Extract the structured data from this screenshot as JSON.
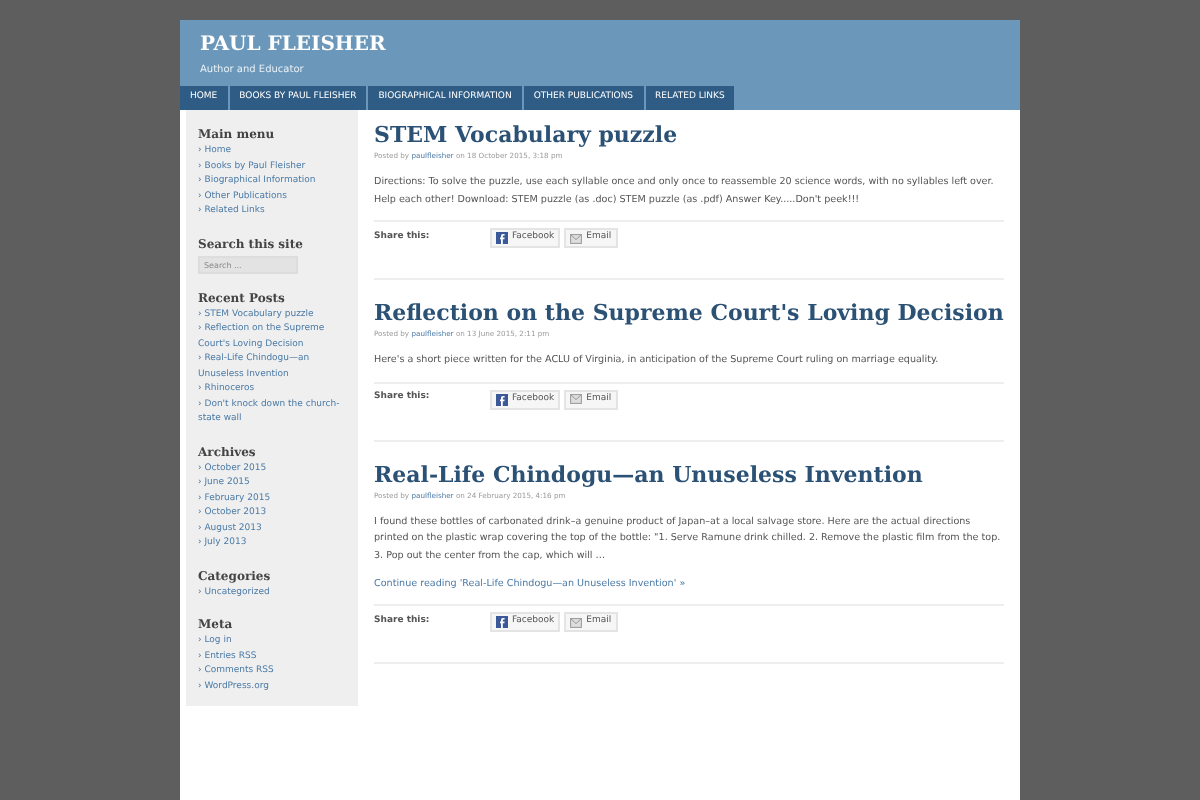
{
  "site": {
    "title": "PAUL FLEISHER",
    "tagline": "Author and Educator"
  },
  "nav": [
    "HOME",
    "BOOKS BY PAUL FLEISHER",
    "BIOGRAPHICAL INFORMATION",
    "OTHER PUBLICATIONS",
    "RELATED LINKS"
  ],
  "sidebar": {
    "bullet": "›",
    "widgets": [
      {
        "kind": "list",
        "title": "Main menu",
        "items": [
          "Home",
          "Books by Paul Fleisher",
          "Biographical Information",
          "Other Publications",
          "Related Links"
        ]
      },
      {
        "kind": "search",
        "title": "Search this site",
        "placeholder": "Search ..."
      },
      {
        "kind": "list",
        "title": "Recent Posts",
        "items": [
          "STEM Vocabulary puzzle",
          "Reflection on the Supreme Court's Loving Decision",
          "Real-Life Chindogu—an Unuseless Invention",
          "Rhinoceros",
          "Don't knock down the church-state wall"
        ]
      },
      {
        "kind": "list",
        "title": "Archives",
        "items": [
          "October 2015",
          "June 2015",
          "February 2015",
          "October 2013",
          "August 2013",
          "July 2013"
        ]
      },
      {
        "kind": "list",
        "title": "Categories",
        "items": [
          "Uncategorized"
        ]
      },
      {
        "kind": "list",
        "title": "Meta",
        "items": [
          "Log in",
          "Entries RSS",
          "Comments RSS",
          "WordPress.org"
        ]
      }
    ]
  },
  "posts": [
    {
      "title": "STEM Vocabulary puzzle",
      "meta": {
        "prefix": "Posted by",
        "author": "paulfleisher",
        "date": "on 18 October 2015, 3:18 pm"
      },
      "excerpt": "Directions: To solve the puzzle, use each syllable once and only once to reassemble 20 science words, with no syllables left over. Help each other! Download: STEM puzzle  (as .doc) STEM puzzle  (as .pdf)      Answer Key.....Don't peek!!!",
      "share_label": "Share this:",
      "share": [
        "Facebook",
        "Email"
      ]
    },
    {
      "title": "Reflection on the Supreme Court's Loving Decision",
      "meta": {
        "prefix": "Posted by",
        "author": "paulfleisher",
        "date": "on 13 June 2015, 2:11 pm"
      },
      "excerpt": "Here's a short piece written for the ACLU of Virginia, in anticipation of the Supreme Court ruling on marriage equality.",
      "share_label": "Share this:",
      "share": [
        "Facebook",
        "Email"
      ]
    },
    {
      "title": "Real-Life Chindogu—an Unuseless Invention",
      "meta": {
        "prefix": "Posted by",
        "author": "paulfleisher",
        "date": "on 24 February 2015, 4:16 pm"
      },
      "excerpt": "I found these bottles of carbonated drink–a genuine product of Japan–at a local salvage store.   Here are the actual directions printed on the plastic wrap covering the top of the bottle: \"1. Serve Ramune drink chilled. 2. Remove the plastic film from the top. 3. Pop out the center from the cap, which will …",
      "more": "Continue reading 'Real-Life Chindogu—an Unuseless Invention' »",
      "share_label": "Share this:",
      "share": [
        "Facebook",
        "Email"
      ]
    }
  ]
}
